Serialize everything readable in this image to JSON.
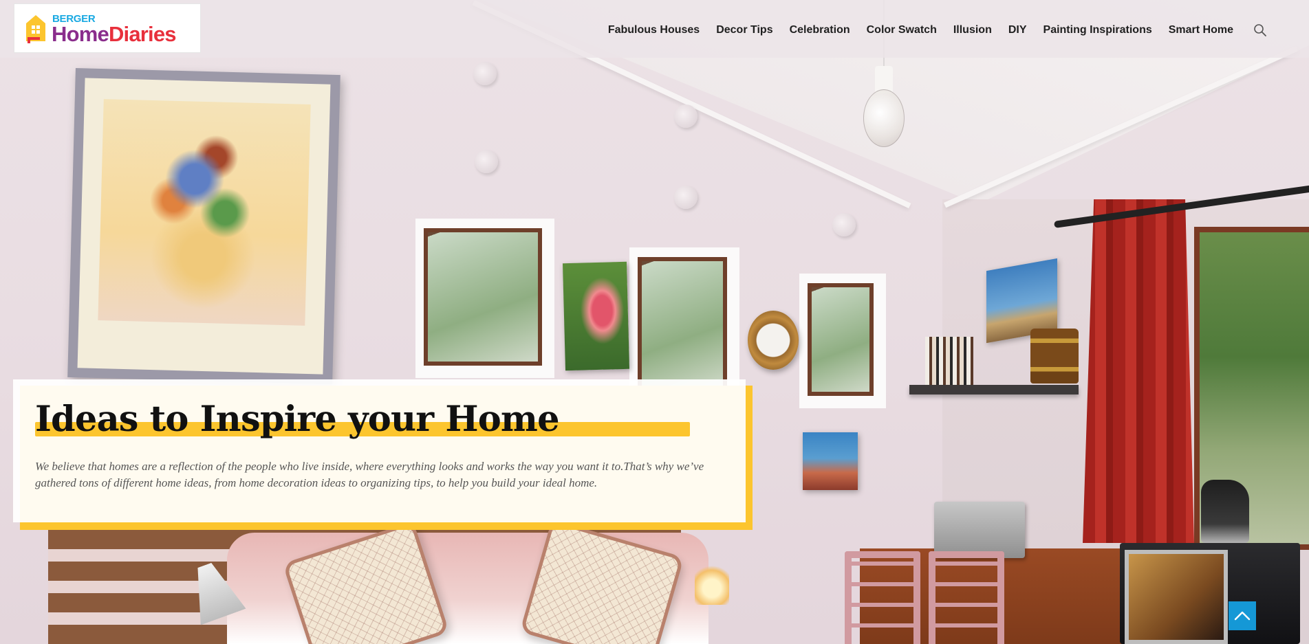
{
  "brand": {
    "company": "BERGER",
    "name_part1": "Home",
    "name_part2": "Diaries",
    "accent_yellow": "#fcc52e",
    "brand_blue": "#19a9e2",
    "brand_purple": "#8a2d8c",
    "brand_red": "#e8303c"
  },
  "nav": {
    "items": [
      {
        "label": "Fabulous Houses"
      },
      {
        "label": "Decor Tips"
      },
      {
        "label": "Celebration"
      },
      {
        "label": "Color Swatch"
      },
      {
        "label": "Illusion"
      },
      {
        "label": "DIY"
      },
      {
        "label": "Painting Inspirations"
      },
      {
        "label": "Smart Home"
      }
    ],
    "search_icon": "search-icon"
  },
  "hero": {
    "title": "Ideas to Inspire your Home",
    "description": "We believe that homes are a reflection of the people who live inside, where everything looks and works the way you want it to.That’s why we’ve gathered tons of different home ideas, from home decoration ideas to organizing tips, to help you build your ideal home.",
    "background": "bedroom-kitchen-photo"
  },
  "back_to_top": {
    "icon": "chevron-up-icon",
    "color": "#1598d6"
  }
}
